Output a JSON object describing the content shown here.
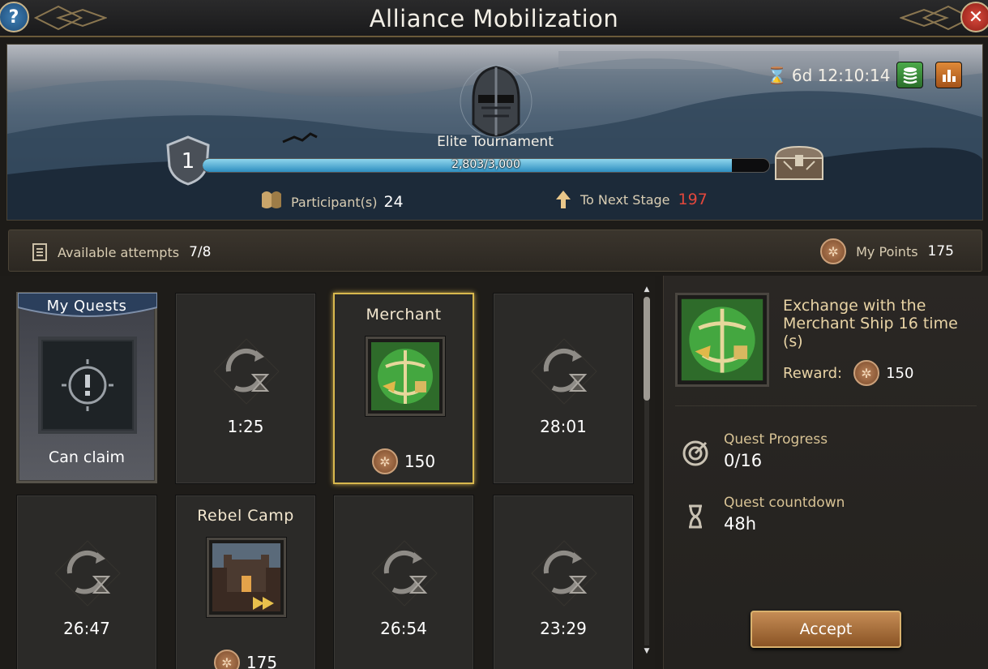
{
  "window": {
    "title": "Alliance Mobilization",
    "help_icon": "?",
    "close_icon": "✕"
  },
  "event": {
    "timer": "6d 12:10:14",
    "name": "Elite Tournament",
    "stage": "1",
    "progress_text": "2,803/3,000",
    "progress_fraction": 0.934,
    "participants_label": "Participant(s)",
    "participants_value": "24",
    "next_stage_label": "To Next Stage",
    "next_stage_value": "197"
  },
  "info": {
    "attempts_label": "Available attempts",
    "attempts_value": "7/8",
    "points_label": "My Points",
    "points_value": "175"
  },
  "quests": [
    {
      "kind": "my",
      "title": "My Quests",
      "status": "Can claim"
    },
    {
      "kind": "cooldown",
      "time": "1:25"
    },
    {
      "kind": "task",
      "title": "Merchant",
      "reward": "150",
      "selected": true
    },
    {
      "kind": "cooldown",
      "time": "28:01"
    },
    {
      "kind": "cooldown",
      "time": "26:47"
    },
    {
      "kind": "task",
      "title": "Rebel Camp",
      "reward": "175"
    },
    {
      "kind": "cooldown",
      "time": "26:54"
    },
    {
      "kind": "cooldown",
      "time": "23:29"
    }
  ],
  "detail": {
    "description": "Exchange with the Merchant Ship 16 time (s)",
    "reward_label": "Reward:",
    "reward_value": "150",
    "progress_label": "Quest Progress",
    "progress_value": "0/16",
    "countdown_label": "Quest countdown",
    "countdown_value": "48h",
    "accept_label": "Accept"
  },
  "colors": {
    "accent_gold": "#d8b84e",
    "progress_blue": "#2e8ec0",
    "alert_red": "#e2473c"
  }
}
